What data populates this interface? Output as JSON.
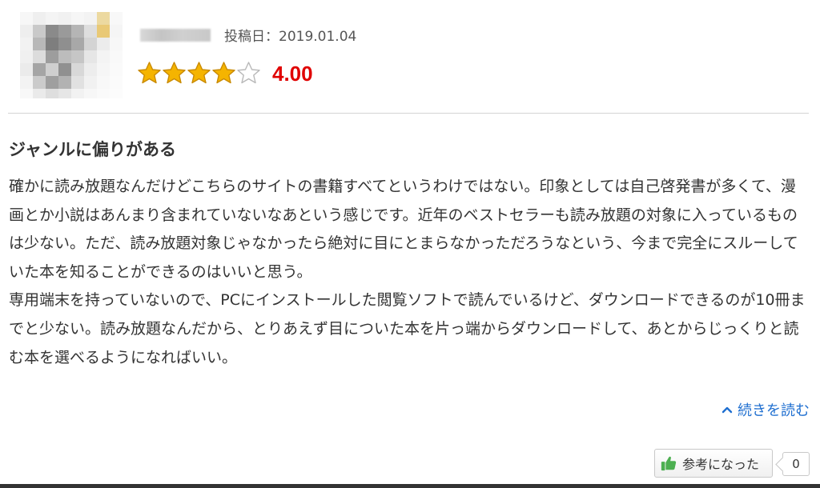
{
  "review": {
    "date_text": "投稿日：2019.01.04",
    "rating": 4,
    "rating_max": 5,
    "score_text": "4.00",
    "title": "ジャンルに偏りがある",
    "paragraphs": [
      "確かに読み放題なんだけどこちらのサイトの書籍すべてというわけではない。印象としては自己啓発書が多くて、漫画とか小説はあんまり含まれていないなあという感じです。近年のベストセラーも読み放題の対象に入っているものは少ない。ただ、読み放題対象じゃなかったら絶対に目にとまらなかっただろうなという、今まで完全にスルーしていた本を知ることができるのはいいと思う。",
      "専用端末を持っていないので、PCにインストールした閲覧ソフトで読んでいるけど、ダウンロードできるのが10冊までと少ない。読み放題なんだから、とりあえず目についた本を片っ端からダウンロードして、あとからじっくりと読む本を選べるようになればいい。"
    ],
    "read_more_label": "続きを読む",
    "helpful_label": "参考になった",
    "helpful_count": "0"
  },
  "colors": {
    "score": "#e00000",
    "star_fill": "#f5b400",
    "link": "#1f6fd0",
    "thumb": "#4caf50"
  },
  "icons": {
    "star": "star-icon",
    "chevron": "chevron-up-icon",
    "thumb": "thumbs-up-icon"
  }
}
